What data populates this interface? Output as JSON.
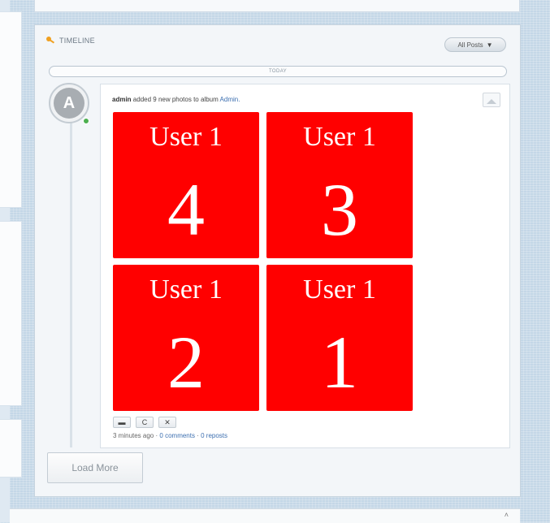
{
  "colors": {
    "tile": "#ff0000",
    "link": "#3c6fb0",
    "online": "#4caf50"
  },
  "timeline": {
    "title": "TIMELINE",
    "title_icon": "key-icon",
    "filter_label": "All Posts",
    "filter_icon": "chevron-down-icon",
    "today_label": "TODAY"
  },
  "post": {
    "avatar_letter": "A",
    "author": "admin",
    "action_text": "added 9 new photos to album",
    "album": "Admin.",
    "photos": [
      {
        "label": "User 1",
        "number": "4"
      },
      {
        "label": "User 1",
        "number": "3"
      },
      {
        "label": "User 1",
        "number": "2"
      },
      {
        "label": "User 1",
        "number": "1"
      }
    ],
    "actions": [
      {
        "icon": "comment-icon",
        "glyph": "▬"
      },
      {
        "icon": "refresh-icon",
        "glyph": "C"
      },
      {
        "icon": "close-icon",
        "glyph": "✕"
      }
    ],
    "time": "3 minutes ago",
    "separator": "·",
    "comments": "0 comments",
    "reposts": "0 reposts"
  },
  "load_more_label": "Load More",
  "scroll_up_glyph": "˄"
}
